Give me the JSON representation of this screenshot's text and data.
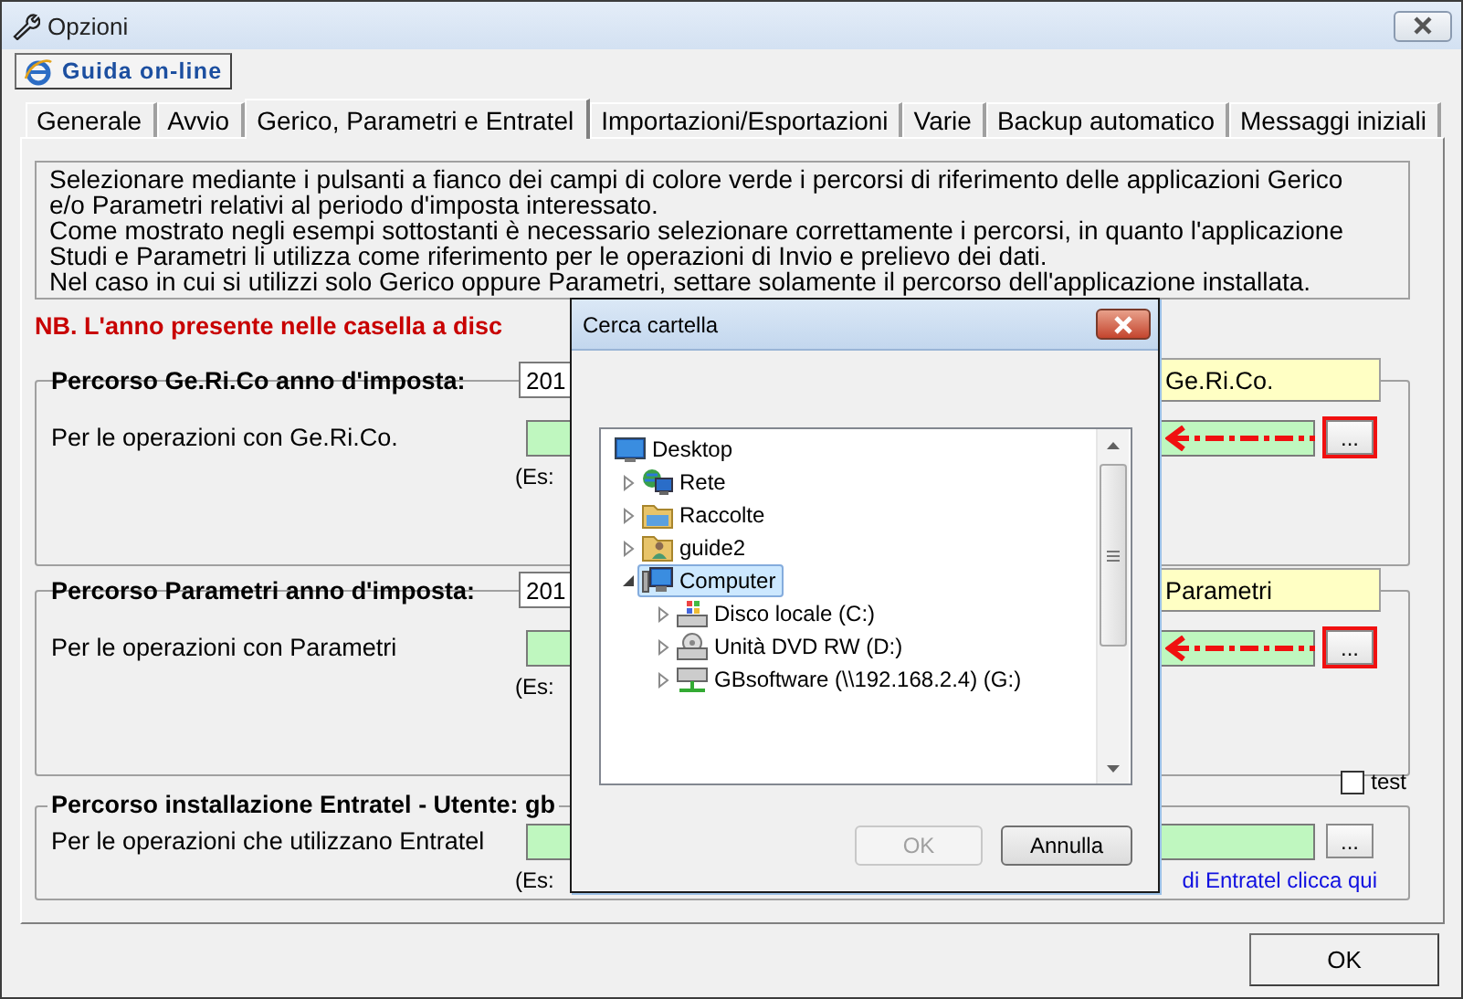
{
  "window": {
    "title": "Opzioni"
  },
  "help_button": {
    "label": "Guida on-line"
  },
  "tabs": [
    {
      "label": "Generale",
      "selected": false
    },
    {
      "label": "Avvio",
      "selected": false
    },
    {
      "label": "Gerico, Parametri e Entratel",
      "selected": true
    },
    {
      "label": "Importazioni/Esportazioni",
      "selected": false
    },
    {
      "label": "Varie",
      "selected": false
    },
    {
      "label": "Backup automatico",
      "selected": false
    },
    {
      "label": "Messaggi iniziali",
      "selected": false
    }
  ],
  "info_lines": [
    "Selezionare mediante i pulsanti a fianco dei campi di colore verde i percorsi di riferimento delle applicazioni Gerico",
    "e/o Parametri relativi al periodo d'imposta interessato.",
    "Come mostrato negli esempi sottostanti è necessario selezionare correttamente i percorsi, in quanto l'applicazione",
    "Studi e Parametri li utilizza come riferimento per le operazioni di Invio e prelievo dei dati.",
    "Nel caso in cui si utilizzi solo Gerico oppure Parametri, settare solamente il percorso dell'applicazione installata."
  ],
  "note": "NB. L'anno presente nelle casella a disc",
  "groups": [
    {
      "legend": "Percorso Ge.Ri.Co anno d'imposta:",
      "year": "201",
      "tag": "Ge.Ri.Co.",
      "label": "Per le operazioni con Ge.Ri.Co.",
      "browse_label": "...",
      "highlighted": true,
      "example": "(Es:"
    },
    {
      "legend": "Percorso Parametri anno d'imposta:",
      "year": "201",
      "tag": "Parametri",
      "label": "Per le operazioni con Parametri",
      "browse_label": "...",
      "highlighted": true,
      "example": "(Es:"
    },
    {
      "legend": "Percorso installazione Entratel - Utente: gb",
      "label": "Per le operazioni che utilizzano Entratel",
      "browse_label": "...",
      "highlighted": false,
      "example": "(Es:",
      "link": "di Entratel clicca qui"
    }
  ],
  "test_checkbox": {
    "label": "test",
    "checked": false
  },
  "ok_button": {
    "label": "OK"
  },
  "dialog": {
    "title": "Cerca cartella",
    "tree": [
      {
        "label": "Desktop",
        "kind": "desktop",
        "selected": false,
        "children": [
          {
            "label": "Rete",
            "kind": "network",
            "selected": false,
            "expanded": false
          },
          {
            "label": "Raccolte",
            "kind": "libraries",
            "selected": false,
            "expanded": false
          },
          {
            "label": "guide2",
            "kind": "user-folder",
            "selected": false,
            "expanded": false
          },
          {
            "label": "Computer",
            "kind": "computer",
            "selected": true,
            "expanded": true,
            "children": [
              {
                "label": "Disco locale (C:)",
                "kind": "drive",
                "selected": false,
                "expanded": false
              },
              {
                "label": "Unità DVD RW (D:)",
                "kind": "dvd-drive",
                "selected": false,
                "expanded": false
              },
              {
                "label": "GBsoftware (\\\\192.168.2.4) (G:)",
                "kind": "network-drive",
                "selected": false,
                "expanded": false
              }
            ]
          }
        ]
      }
    ],
    "buttons": [
      {
        "label": "OK",
        "disabled": true
      },
      {
        "label": "Annulla",
        "disabled": false
      }
    ]
  }
}
